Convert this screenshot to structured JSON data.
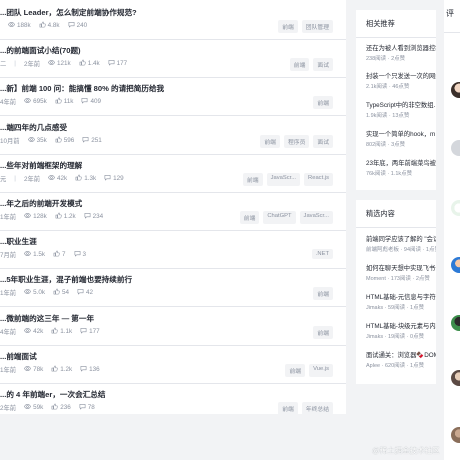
{
  "feed": {
    "articles": [
      {
        "title": "...团队 Leader，怎么制定前端协作规范?",
        "author": "",
        "time": "",
        "views": "188k",
        "likes": "4.8k",
        "comments": "240",
        "tags": [
          "前端",
          "团队管理"
        ]
      },
      {
        "title": "...的前端面试小结(70题)",
        "author": "二",
        "time": "2年前",
        "views": "121k",
        "likes": "1.4k",
        "comments": "177",
        "tags": [
          "前端",
          "面试"
        ]
      },
      {
        "title": "...新】前端 100 问：能搞懂 80% 的请把简历给我",
        "author": "",
        "time": "4年前",
        "views": "695k",
        "likes": "11k",
        "comments": "409",
        "tags": [
          "前端"
        ]
      },
      {
        "title": "...端四年的几点感受",
        "author": "",
        "time": "10月前",
        "views": "35k",
        "likes": "596",
        "comments": "251",
        "tags": [
          "前端",
          "程序员",
          "面试"
        ]
      },
      {
        "title": "...些年对前端框架的理解",
        "author": "元",
        "time": "2年前",
        "views": "42k",
        "likes": "1.3k",
        "comments": "129",
        "tags": [
          "前端",
          "JavaScr...",
          "React.js"
        ]
      },
      {
        "title": "...年之后的前端开发模式",
        "author": "",
        "time": "1年前",
        "views": "128k",
        "likes": "1.2k",
        "comments": "234",
        "tags": [
          "前端",
          "ChatGPT",
          "JavaScr..."
        ]
      },
      {
        "title": "...职业生涯",
        "author": "",
        "time": "7月前",
        "views": "1.5k",
        "likes": "7",
        "comments": "3",
        "tags": [
          ".NET"
        ]
      },
      {
        "title": "...5年职业生涯，混子前端也要持续前行",
        "author": "",
        "time": "1年前",
        "views": "5.0k",
        "likes": "54",
        "comments": "42",
        "tags": [
          "前端"
        ]
      },
      {
        "title": "...微前端的这三年 — 第一年",
        "author": "",
        "time": "4年前",
        "views": "42k",
        "likes": "1.1k",
        "comments": "177",
        "tags": [
          "前端"
        ]
      },
      {
        "title": "...前端面试",
        "author": "",
        "time": "1年前",
        "views": "78k",
        "likes": "1.2k",
        "comments": "136",
        "tags": [
          "前端",
          "Vue.js"
        ]
      },
      {
        "title": "...的 4 年前端er，一次会汇总结",
        "author": "",
        "time": "2年前",
        "views": "59k",
        "likes": "236",
        "comments": "78",
        "tags": [
          "前端",
          "年终总结"
        ]
      }
    ]
  },
  "related": {
    "heading": "相关推荐",
    "items": [
      {
        "title": "还在为被人看到浏览器控制台…",
        "meta": "238阅读 · 2点赞"
      },
      {
        "title": "封装一个只发送一次的网络…",
        "meta": "2.1k阅读 · 46点赞"
      },
      {
        "title": "TypeScript中的非空数组…",
        "meta": "1.9k阅读 · 13点赞"
      },
      {
        "title": "实现一个简单的hook，m…",
        "meta": "802阅读 · 3点赞"
      },
      {
        "title": "23年底，两年前端菜鸟被…",
        "meta": "76k阅读 · 1.1k点赞"
      }
    ]
  },
  "featured": {
    "heading": "精选内容",
    "items": [
      {
        "title": "前端同学应该了解的 \"会话…",
        "meta": "前端阿彪老板 · 94阅读 · 1点赞"
      },
      {
        "title": "如何在聊天想中实现飞书长…",
        "meta": "Moment · 173阅读 · 2点赞"
      },
      {
        "title": "HTML基础-元信息与字符编…",
        "meta": "Jimaks · 59阅读 · 1点赞"
      },
      {
        "title": "HTML基础-块级元素与内联…",
        "meta": "Jimaks · 19阅读 · 0点赞"
      },
      {
        "title": "面试通关：浏览器🍫DOM…",
        "meta": "Aplee · 620阅读 · 1点赞"
      }
    ]
  },
  "right_panel": {
    "title": "评"
  },
  "watermark": "@稀土掘金技术社区",
  "colors": {
    "accent": "#1e80ff",
    "meta": "#8a919f",
    "border": "#e4e6eb",
    "page_bg": "#f2f3f5"
  }
}
